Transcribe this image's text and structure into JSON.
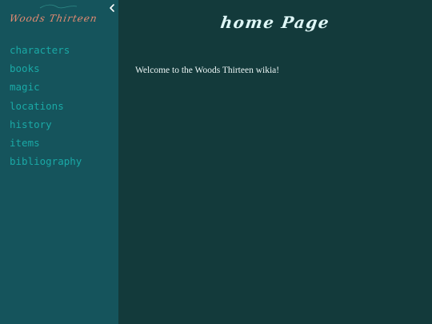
{
  "sidebar": {
    "brand": "Woods Thirteen",
    "nav_items": [
      {
        "label": "characters"
      },
      {
        "label": "books"
      },
      {
        "label": "magic"
      },
      {
        "label": "locations"
      },
      {
        "label": "history"
      },
      {
        "label": "items"
      },
      {
        "label": "bibliography"
      }
    ]
  },
  "main": {
    "title": "home Page",
    "welcome_text": "Welcome to the Woods Thirteen wikia!"
  },
  "colors": {
    "sidebar_bg": "#15545c",
    "main_bg": "#133a3b",
    "nav_text": "#1aa9a6",
    "brand_text": "#e58b72"
  },
  "icons": {
    "collapse": "chevron-left-icon",
    "flourish": "flourish-icon"
  }
}
